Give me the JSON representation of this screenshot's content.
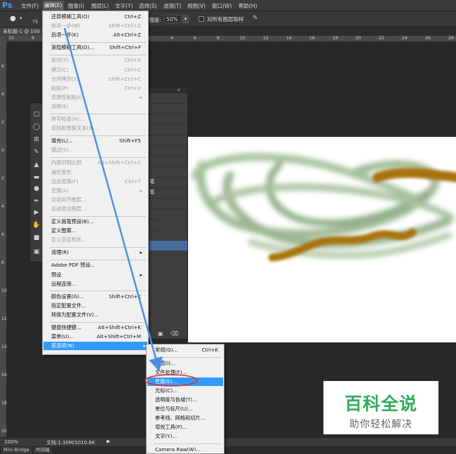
{
  "app": {
    "logo": "Ps"
  },
  "menubar": {
    "items": [
      "文件(F)",
      "编辑(E)",
      "图像(I)",
      "图层(L)",
      "文字(Y)",
      "选择(S)",
      "滤镜(T)",
      "视图(V)",
      "窗口(W)",
      "帮助(H)"
    ],
    "active_index": 1
  },
  "options": {
    "brush_size": "75",
    "strength_label": "强度:",
    "strength_value": "50%",
    "sample_all_label": "对所有图层取样"
  },
  "document": {
    "tab_title": "未标题-1 @ 100"
  },
  "ruler": {
    "h_marks": [
      "10",
      "8",
      "6",
      "4",
      "2",
      "0",
      "2",
      "4",
      "6",
      "8",
      "10",
      "12",
      "14",
      "16",
      "18",
      "20",
      "22",
      "24",
      "26",
      "28"
    ],
    "v_marks": [
      "6",
      "4",
      "2",
      "0",
      "2",
      "4",
      "6",
      "8",
      "10",
      "12",
      "14",
      "16",
      "18",
      "20"
    ]
  },
  "panel": {
    "close": "«",
    "x": "x",
    "labels": [
      "笔",
      "笔"
    ]
  },
  "edit_menu": {
    "items": [
      {
        "label": "还原模糊工具(O)",
        "shortcut": "Ctrl+Z",
        "disabled": false
      },
      {
        "label": "前进一步(W)",
        "shortcut": "Shift+Ctrl+Z",
        "disabled": true
      },
      {
        "label": "后退一步(K)",
        "shortcut": "Alt+Ctrl+Z",
        "disabled": false
      },
      {
        "sep": true
      },
      {
        "label": "渐隐模糊工具(D)...",
        "shortcut": "Shift+Ctrl+F",
        "disabled": false
      },
      {
        "sep": true
      },
      {
        "label": "剪切(T)",
        "shortcut": "Ctrl+X",
        "disabled": true
      },
      {
        "label": "拷贝(C)",
        "shortcut": "Ctrl+C",
        "disabled": true
      },
      {
        "label": "合并拷贝(Y)",
        "shortcut": "Shift+Ctrl+C",
        "disabled": true
      },
      {
        "label": "粘贴(P)",
        "shortcut": "Ctrl+V",
        "disabled": true
      },
      {
        "label": "选择性粘贴(I)",
        "shortcut": "",
        "disabled": true,
        "submenu": true
      },
      {
        "label": "清除(E)",
        "shortcut": "",
        "disabled": true
      },
      {
        "sep": true
      },
      {
        "label": "拼写检查(H)...",
        "shortcut": "",
        "disabled": true
      },
      {
        "label": "查找和替换文本(X)...",
        "shortcut": "",
        "disabled": true
      },
      {
        "sep": true
      },
      {
        "label": "填充(L)...",
        "shortcut": "Shift+F5",
        "disabled": false
      },
      {
        "label": "描边(S)...",
        "shortcut": "",
        "disabled": true
      },
      {
        "sep": true
      },
      {
        "label": "内容识别比例",
        "shortcut": "Alt+Shift+Ctrl+C",
        "disabled": true
      },
      {
        "label": "操控变形",
        "shortcut": "",
        "disabled": true
      },
      {
        "label": "自由变换(F)",
        "shortcut": "Ctrl+T",
        "disabled": true
      },
      {
        "label": "变换(A)",
        "shortcut": "",
        "disabled": true,
        "submenu": true
      },
      {
        "label": "自动对齐图层...",
        "shortcut": "",
        "disabled": true
      },
      {
        "label": "自动混合图层...",
        "shortcut": "",
        "disabled": true
      },
      {
        "sep": true
      },
      {
        "label": "定义画笔预设(B)...",
        "shortcut": "",
        "disabled": false
      },
      {
        "label": "定义图案...",
        "shortcut": "",
        "disabled": false
      },
      {
        "label": "定义自定形状...",
        "shortcut": "",
        "disabled": true
      },
      {
        "sep": true
      },
      {
        "label": "清理(R)",
        "shortcut": "",
        "disabled": false,
        "submenu": true
      },
      {
        "sep": true
      },
      {
        "label": "Adobe PDF 预设...",
        "shortcut": "",
        "disabled": false
      },
      {
        "label": "预设",
        "shortcut": "",
        "disabled": false,
        "submenu": true
      },
      {
        "label": "远程连接...",
        "shortcut": "",
        "disabled": false
      },
      {
        "sep": true
      },
      {
        "label": "颜色设置(G)...",
        "shortcut": "Shift+Ctrl+K",
        "disabled": false
      },
      {
        "label": "指定配置文件...",
        "shortcut": "",
        "disabled": false
      },
      {
        "label": "转换为配置文件(V)...",
        "shortcut": "",
        "disabled": false
      },
      {
        "sep": true
      },
      {
        "label": "键盘快捷键...",
        "shortcut": "Alt+Shift+Ctrl+K",
        "disabled": false
      },
      {
        "label": "菜单(U)...",
        "shortcut": "Alt+Shift+Ctrl+M",
        "disabled": false
      },
      {
        "label": "首选项(N)",
        "shortcut": "",
        "disabled": false,
        "submenu": true,
        "highlighted": true
      }
    ]
  },
  "prefs_submenu": {
    "items": [
      {
        "label": "常规(G)...",
        "shortcut": "Ctrl+K"
      },
      {
        "sep": true
      },
      {
        "label": "界面(I)...",
        "shortcut": ""
      },
      {
        "label": "文件处理(F)...",
        "shortcut": ""
      },
      {
        "label": "性能(E)...",
        "shortcut": "",
        "highlighted": true
      },
      {
        "label": "光标(C)...",
        "shortcut": ""
      },
      {
        "label": "透明度与色域(T)...",
        "shortcut": ""
      },
      {
        "label": "单位与标尺(U)...",
        "shortcut": ""
      },
      {
        "label": "参考线、网格和切片...",
        "shortcut": ""
      },
      {
        "label": "增效工具(P)...",
        "shortcut": ""
      },
      {
        "label": "文字(Y)...",
        "shortcut": ""
      },
      {
        "sep": true
      },
      {
        "label": "Camera Raw(W)...",
        "shortcut": ""
      }
    ]
  },
  "status": {
    "zoom": "100%",
    "doc_info": "文档:1.30M/1010.6K"
  },
  "bottom_tabs": [
    "Mini Bridge",
    "时间轴"
  ],
  "watermark": {
    "title": "百科全说",
    "subtitle": "助你轻松解决"
  },
  "colors": {
    "accent": "#3399ff",
    "annotation": "#4a90e2",
    "circle": "#e0282d",
    "stroke_brown": "#a8730a",
    "stroke_green": "#8fae84",
    "watermark_green": "#2fae5e"
  }
}
